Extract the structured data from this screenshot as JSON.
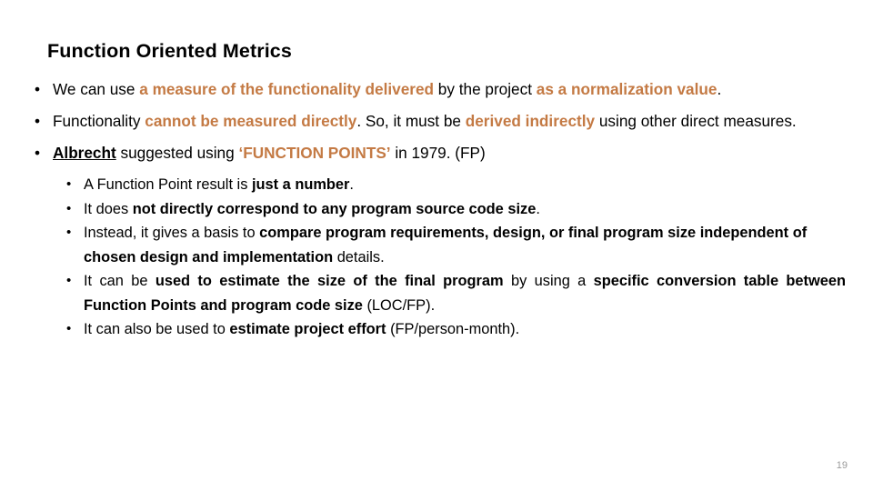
{
  "slide": {
    "title": "Function Oriented Metrics",
    "accent_color": "#C47A44",
    "page_number": "19",
    "bullets": [
      {
        "marker": "•",
        "segments": [
          {
            "text": "We can use ",
            "style": "plain"
          },
          {
            "text": "a measure of the functionality delivered",
            "style": "accent"
          },
          {
            "text": " by the project ",
            "style": "plain"
          },
          {
            "text": "as a normalization value",
            "style": "accent"
          },
          {
            "text": ".",
            "style": "plain"
          }
        ]
      },
      {
        "marker": "•",
        "segments": [
          {
            "text": "Functionality ",
            "style": "plain"
          },
          {
            "text": "cannot be measured directly",
            "style": "accent"
          },
          {
            "text": ". So, it must be ",
            "style": "plain"
          },
          {
            "text": "derived indirectly",
            "style": "accent"
          },
          {
            "text": " using other direct measures.",
            "style": "plain"
          }
        ]
      },
      {
        "marker": "•",
        "segments": [
          {
            "text": "Albrecht",
            "style": "bold-underline"
          },
          {
            "text": " suggested using ",
            "style": "plain"
          },
          {
            "text": "‘FUNCTION POINTS’",
            "style": "accent"
          },
          {
            "text": " in 1979. (FP)",
            "style": "plain"
          }
        ]
      }
    ],
    "sub_bullets": [
      {
        "marker": "•",
        "justified": false,
        "segments": [
          {
            "text": "A Function Point result is ",
            "style": "plain"
          },
          {
            "text": "just a number",
            "style": "bold"
          },
          {
            "text": ".",
            "style": "plain"
          }
        ]
      },
      {
        "marker": "•",
        "justified": false,
        "segments": [
          {
            "text": "It does ",
            "style": "plain"
          },
          {
            "text": "not directly correspond to any program source code size",
            "style": "bold"
          },
          {
            "text": ".",
            "style": "plain"
          }
        ]
      },
      {
        "marker": "•",
        "justified": false,
        "segments": [
          {
            "text": "Instead, it gives a basis to ",
            "style": "plain"
          },
          {
            "text": "compare program requirements, design, or final program size independent of chosen design and implementation",
            "style": "bold"
          },
          {
            "text": " details.",
            "style": "plain"
          }
        ]
      },
      {
        "marker": "•",
        "justified": true,
        "segments": [
          {
            "text": "It can be ",
            "style": "plain"
          },
          {
            "text": "used to estimate the size of the final program",
            "style": "bold"
          },
          {
            "text": " by using a ",
            "style": "plain"
          },
          {
            "text": "specific conversion table between Function Points and program code size",
            "style": "bold"
          },
          {
            "text": " (LOC/FP).",
            "style": "plain"
          }
        ]
      },
      {
        "marker": "•",
        "justified": false,
        "segments": [
          {
            "text": "It can also be used to ",
            "style": "plain"
          },
          {
            "text": "estimate project effort",
            "style": "bold"
          },
          {
            "text": " (FP/person-month).",
            "style": "plain"
          }
        ]
      }
    ]
  }
}
